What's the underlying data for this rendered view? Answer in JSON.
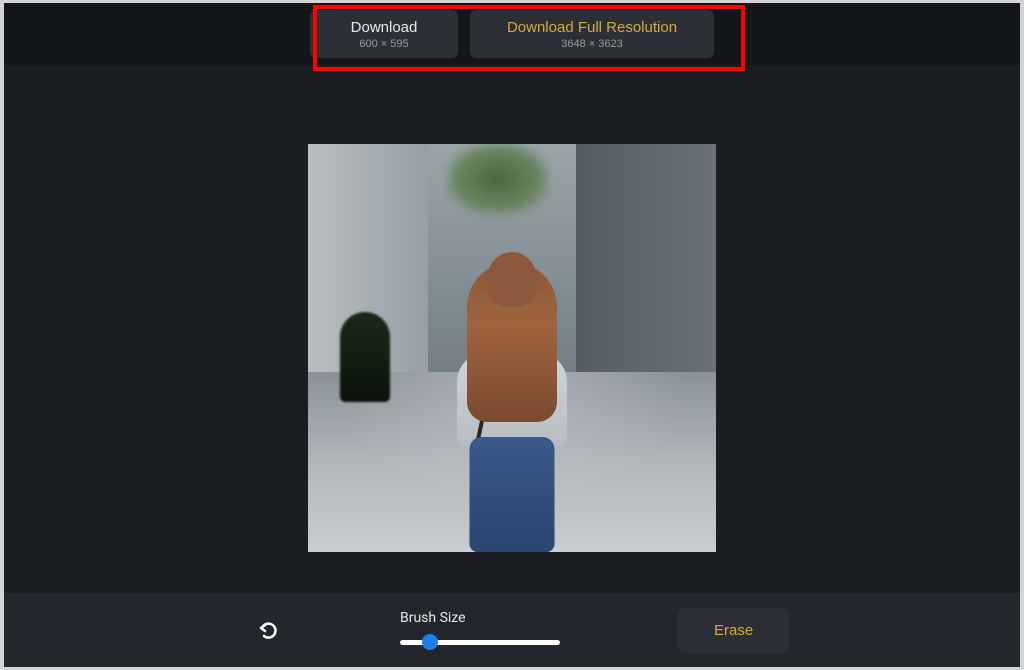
{
  "header": {
    "download": {
      "label": "Download",
      "dimensions": "600 × 595"
    },
    "downloadFull": {
      "label": "Download Full Resolution",
      "dimensions": "3648 × 3623"
    }
  },
  "toolbar": {
    "brushLabel": "Brush Size",
    "eraseLabel": "Erase"
  }
}
